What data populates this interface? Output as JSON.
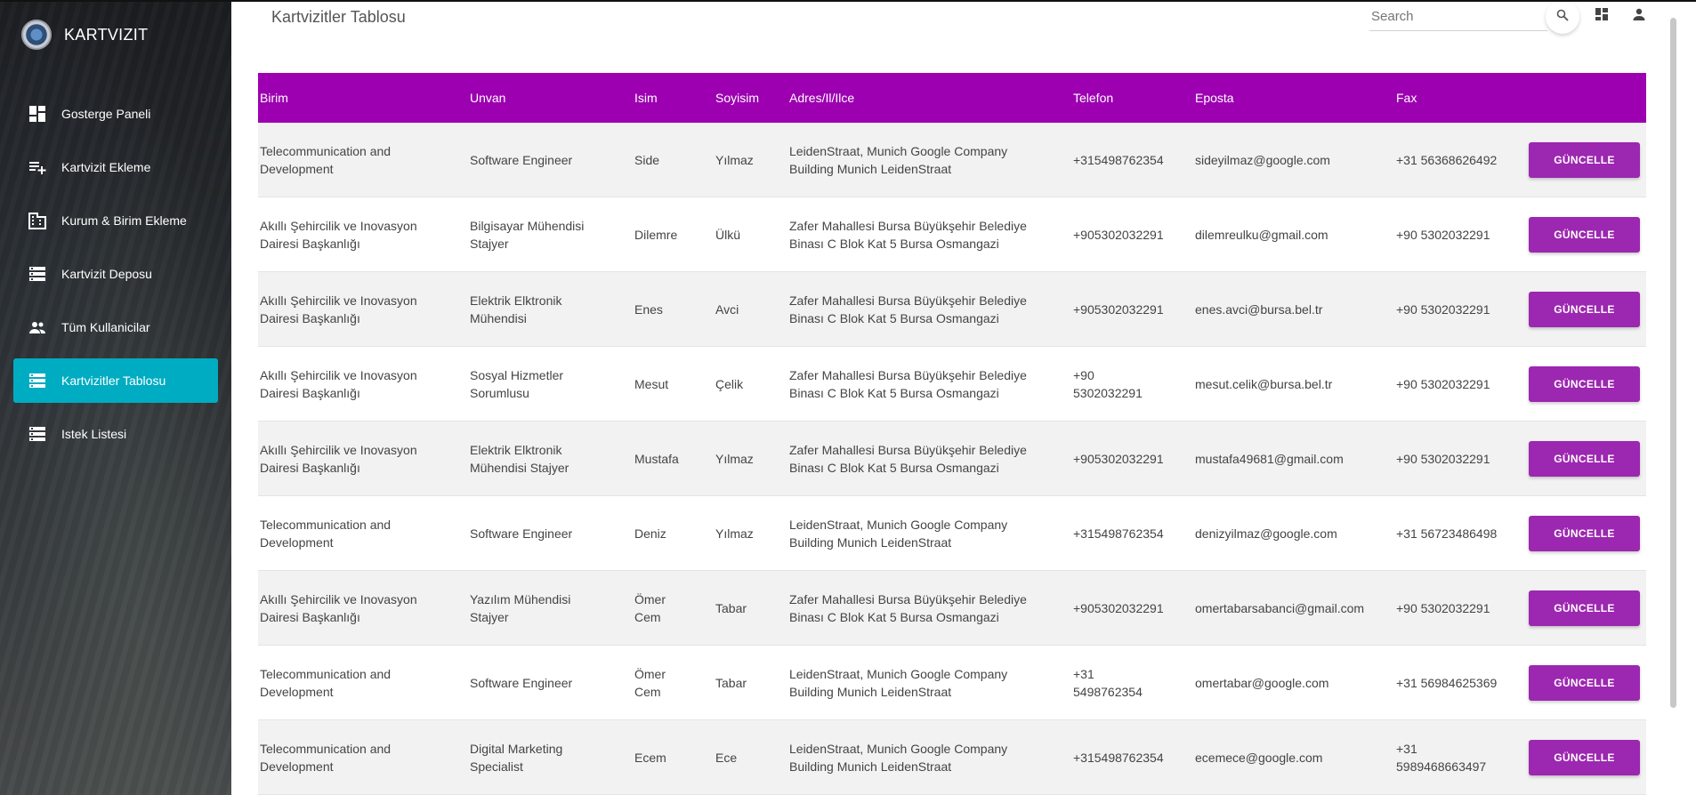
{
  "app": {
    "brand": "KARTVIZIT"
  },
  "sidebar": {
    "items": [
      {
        "label": "Gosterge Paneli",
        "icon": "dashboard-icon",
        "active": false
      },
      {
        "label": "Kartvizit Ekleme",
        "icon": "playlist-add-icon",
        "active": false
      },
      {
        "label": "Kurum & Birim Ekleme",
        "icon": "building-icon",
        "active": false
      },
      {
        "label": "Kartvizit Deposu",
        "icon": "storage-icon",
        "active": false
      },
      {
        "label": "Tüm Kullanicilar",
        "icon": "people-icon",
        "active": false
      },
      {
        "label": "Kartvizitler Tablosu",
        "icon": "storage-icon",
        "active": true
      },
      {
        "label": "Istek Listesi",
        "icon": "storage-icon",
        "active": false
      }
    ]
  },
  "header": {
    "title": "Kartvizitler Tablosu",
    "search_placeholder": "Search"
  },
  "table": {
    "columns": [
      "Birim",
      "Unvan",
      "Isim",
      "Soyisim",
      "Adres/Il/Ilce",
      "Telefon",
      "Eposta",
      "Fax"
    ],
    "button_label": "GÜNCELLE",
    "rows": [
      {
        "birim": [
          "Telecommunication and",
          "Development"
        ],
        "unvan": [
          "Software Engineer"
        ],
        "isim": [
          "Side"
        ],
        "soyisim": "Yılmaz",
        "adres": [
          "LeidenStraat, Munich Google Company",
          "Building Munich LeidenStraat"
        ],
        "telefon": [
          "+315498762354"
        ],
        "eposta": "sideyilmaz@google.com",
        "fax": [
          "+31 56368626492"
        ]
      },
      {
        "birim": [
          "Akıllı Şehircilik ve Inovasyon",
          "Dairesi Başkanlığı"
        ],
        "unvan": [
          "Bilgisayar Mühendisi",
          "Stajyer"
        ],
        "isim": [
          "Dilemre"
        ],
        "soyisim": "Ülkü",
        "adres": [
          "Zafer Mahallesi Bursa Büyükşehir Belediye",
          "Binası C Blok Kat 5 Bursa Osmangazi"
        ],
        "telefon": [
          "+905302032291"
        ],
        "eposta": "dilemreulku@gmail.com",
        "fax": [
          "+90 5302032291"
        ]
      },
      {
        "birim": [
          "Akıllı Şehircilik ve Inovasyon",
          "Dairesi Başkanlığı"
        ],
        "unvan": [
          "Elektrik Elktronik",
          "Mühendisi"
        ],
        "isim": [
          "Enes"
        ],
        "soyisim": "Avci",
        "adres": [
          "Zafer Mahallesi Bursa Büyükşehir Belediye",
          "Binası C Blok Kat 5 Bursa Osmangazi"
        ],
        "telefon": [
          "+905302032291"
        ],
        "eposta": "enes.avci@bursa.bel.tr",
        "fax": [
          "+90 5302032291"
        ]
      },
      {
        "birim": [
          "Akıllı Şehircilik ve Inovasyon",
          "Dairesi Başkanlığı"
        ],
        "unvan": [
          "Sosyal Hizmetler",
          "Sorumlusu"
        ],
        "isim": [
          "Mesut"
        ],
        "soyisim": "Çelik",
        "adres": [
          "Zafer Mahallesi Bursa Büyükşehir Belediye",
          "Binası C Blok Kat 5 Bursa Osmangazi"
        ],
        "telefon": [
          "+90",
          "5302032291"
        ],
        "eposta": "mesut.celik@bursa.bel.tr",
        "fax": [
          "+90 5302032291"
        ]
      },
      {
        "birim": [
          "Akıllı Şehircilik ve Inovasyon",
          "Dairesi Başkanlığı"
        ],
        "unvan": [
          "Elektrik Elktronik",
          "Mühendisi Stajyer"
        ],
        "isim": [
          "Mustafa"
        ],
        "soyisim": "Yılmaz",
        "adres": [
          "Zafer Mahallesi Bursa Büyükşehir Belediye",
          "Binası C Blok Kat 5 Bursa Osmangazi"
        ],
        "telefon": [
          "+905302032291"
        ],
        "eposta": "mustafa49681@gmail.com",
        "fax": [
          "+90 5302032291"
        ]
      },
      {
        "birim": [
          "Telecommunication and",
          "Development"
        ],
        "unvan": [
          "Software Engineer"
        ],
        "isim": [
          "Deniz"
        ],
        "soyisim": "Yılmaz",
        "adres": [
          "LeidenStraat, Munich Google Company",
          "Building Munich LeidenStraat"
        ],
        "telefon": [
          "+315498762354"
        ],
        "eposta": "denizyilmaz@google.com",
        "fax": [
          "+31 56723486498"
        ]
      },
      {
        "birim": [
          "Akıllı Şehircilik ve Inovasyon",
          "Dairesi Başkanlığı"
        ],
        "unvan": [
          "Yazılım Mühendisi",
          "Stajyer"
        ],
        "isim": [
          "Ömer",
          "Cem"
        ],
        "soyisim": "Tabar",
        "adres": [
          "Zafer Mahallesi Bursa Büyükşehir Belediye",
          "Binası C Blok Kat 5 Bursa Osmangazi"
        ],
        "telefon": [
          "+905302032291"
        ],
        "eposta": "omertabarsabanci@gmail.com",
        "fax": [
          "+90 5302032291"
        ]
      },
      {
        "birim": [
          "Telecommunication and",
          "Development"
        ],
        "unvan": [
          "Software Engineer"
        ],
        "isim": [
          "Ömer",
          "Cem"
        ],
        "soyisim": "Tabar",
        "adres": [
          "LeidenStraat, Munich Google Company",
          "Building Munich LeidenStraat"
        ],
        "telefon": [
          "+31",
          "5498762354"
        ],
        "eposta": "omertabar@google.com",
        "fax": [
          "+31 56984625369"
        ]
      },
      {
        "birim": [
          "Telecommunication and",
          "Development"
        ],
        "unvan": [
          "Digital Marketing",
          "Specialist"
        ],
        "isim": [
          "Ecem"
        ],
        "soyisim": "Ece",
        "adres": [
          "LeidenStraat, Munich Google Company",
          "Building Munich LeidenStraat"
        ],
        "telefon": [
          "+315498762354"
        ],
        "eposta": "ecemece@google.com",
        "fax": [
          "+31",
          "5989468663497"
        ]
      }
    ]
  },
  "colors": {
    "header": "#9c00b0",
    "button": "#9c27b0",
    "active_nav": "#00acc1"
  }
}
